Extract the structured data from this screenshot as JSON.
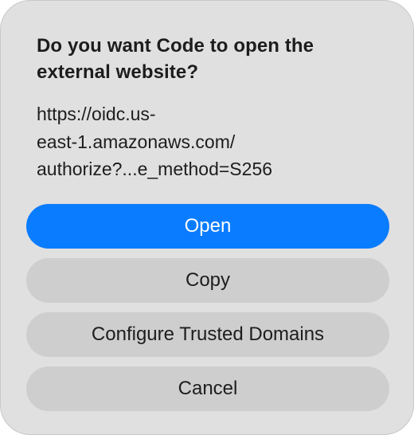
{
  "dialog": {
    "title": "Do you want Code to open the external website?",
    "message_lines": [
      "https://oidc.us-",
      "east-1.amazonaws.com/",
      "authorize?...e_method=S256"
    ],
    "buttons": {
      "open": "Open",
      "copy": "Copy",
      "configure": "Configure Trusted Domains",
      "cancel": "Cancel"
    }
  },
  "colors": {
    "primary": "#0a7cff",
    "dialog_bg": "#e0e0e0",
    "button_bg": "#cecece"
  }
}
